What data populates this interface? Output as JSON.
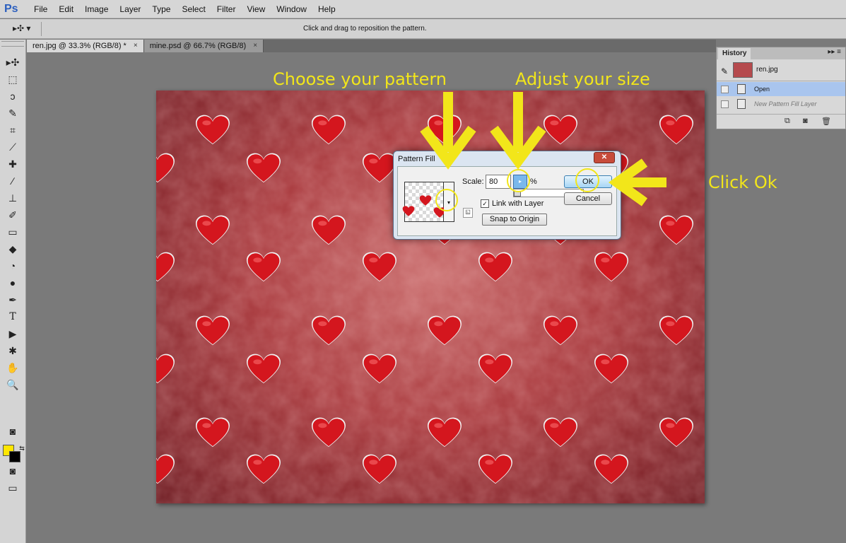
{
  "app": {
    "logo": "Ps"
  },
  "menu": [
    "File",
    "Edit",
    "Image",
    "Layer",
    "Type",
    "Select",
    "Filter",
    "View",
    "Window",
    "Help"
  ],
  "options_bar": {
    "hint": "Click and drag to reposition the pattern.",
    "move_tool_glyph": "▸✣ ▾"
  },
  "tabs": [
    {
      "label": "ren.jpg @ 33.3% (RGB/8) *",
      "active": true
    },
    {
      "label": "mine.psd @ 66.7% (RGB/8)",
      "active": false
    }
  ],
  "tab_close_glyph": "×",
  "toolbar": {
    "icons": [
      "move-icon",
      "marquee-icon",
      "lasso-icon",
      "quick-select-icon",
      "crop-icon",
      "eyedropper-icon",
      "healing-brush-icon",
      "brush-icon",
      "clone-stamp-icon",
      "history-brush-icon",
      "eraser-icon",
      "paint-bucket-icon",
      "blur-icon",
      "dodge-icon",
      "pen-icon",
      "type-icon",
      "path-select-icon",
      "custom-shape-icon",
      "hand-icon",
      "zoom-icon"
    ],
    "glyphs": [
      "▸✣",
      "⬚",
      "ↄ",
      "✎",
      "⌗",
      "⟋",
      "✚",
      "∕",
      "⊥",
      "✐",
      "▭",
      "◆",
      "◔",
      "●",
      "✒",
      "T",
      "▶",
      "✱",
      "✋",
      "🔍"
    ],
    "foreground_color": "#ffe600",
    "background_color": "#000000",
    "quickmask_glyph": "◙",
    "screenmode_glyph": "▭"
  },
  "history_panel": {
    "tab": "History",
    "menu_glyph": "▸▸ ≡",
    "snapshot_label": "ren.jpg",
    "snapshot_icon_glyph": "✎",
    "rows": [
      {
        "label": "Open",
        "selected": true
      },
      {
        "label": "New Pattern Fill Layer",
        "selected": false
      }
    ],
    "footer_glyphs": [
      "⧉",
      "◙",
      "🗑"
    ]
  },
  "dialog": {
    "title": "Pattern Fill",
    "close_glyph": "✕",
    "scale_label": "Scale:",
    "scale_value": "80",
    "percent": "%",
    "slider_glyph": "▸",
    "dropdown_glyph": "▾",
    "new_preset_glyph": "◱",
    "link_with_layer": "Link with Layer",
    "link_checked": true,
    "check_glyph": "✓",
    "snap_button": "Snap to Origin",
    "ok_button": "OK",
    "cancel_button": "Cancel"
  },
  "annotations": {
    "choose_pattern": "Choose your pattern",
    "adjust_size": "Adjust your size",
    "click_ok": "Click Ok",
    "color": "#f2e61a"
  },
  "canvas": {
    "heart_color": "#d4161e",
    "outline_color": "#f0f0f0"
  }
}
